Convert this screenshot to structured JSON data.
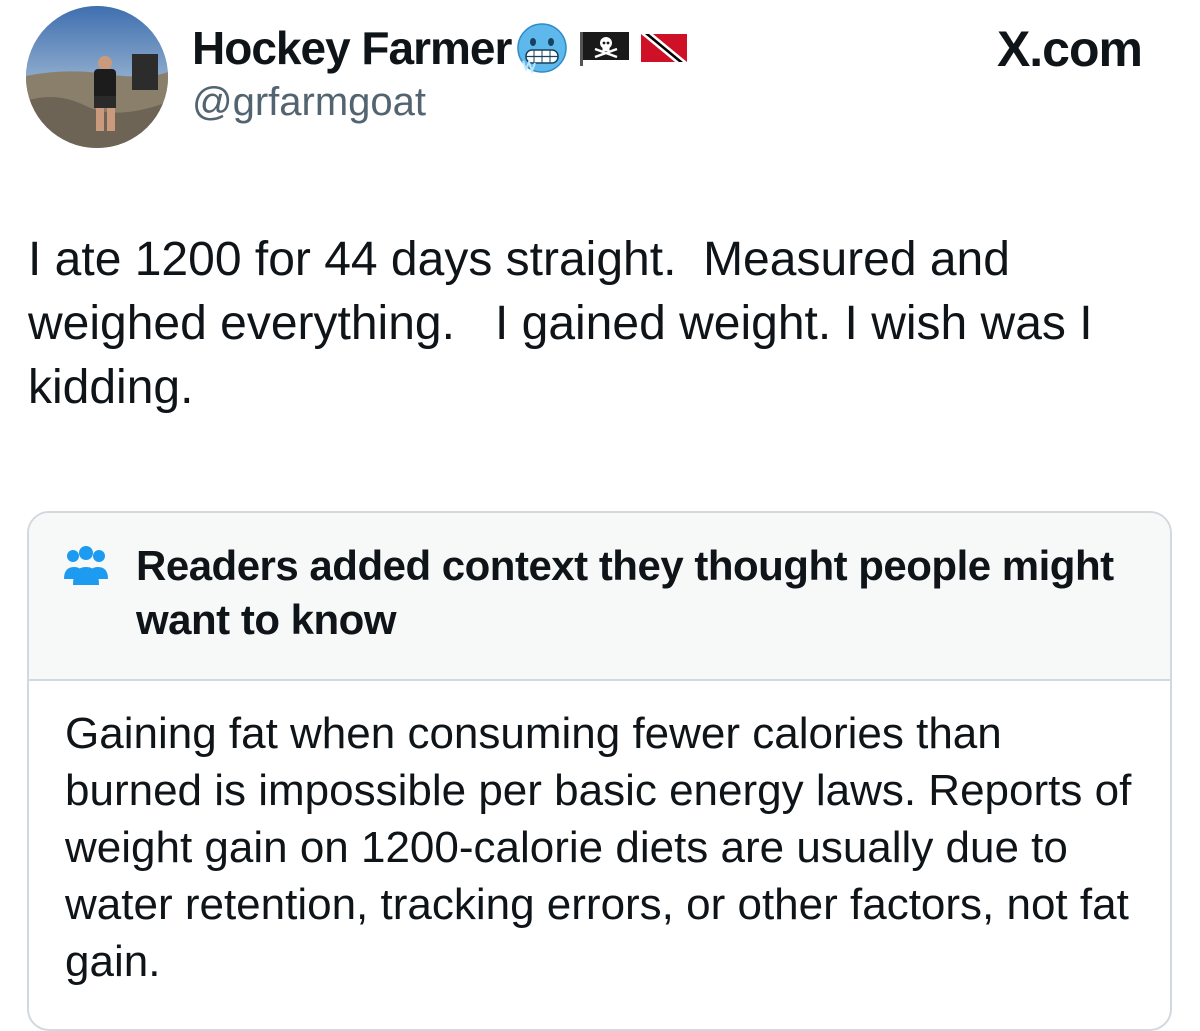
{
  "post": {
    "display_name": "Hockey Farmer",
    "handle": "@grfarmgoat",
    "site_label": "X.com",
    "name_emojis": [
      "cold-face-emoji-icon",
      "pirate-flag-icon",
      "trinidad-and-tobago-flag-icon"
    ],
    "text": "I ate 1200 for 44 days straight.  Measured and weighed everything.   I gained weight. I wish was I kidding."
  },
  "community_note": {
    "icon": "people-group-icon",
    "header": "Readers added context they thought people might want to know",
    "body": "Gaining fat when consuming fewer calories than burned is impossible per basic energy laws. Reports of weight gain on 1200-calorie diets are usually due to water retention, tracking errors, or other factors, not fat gain."
  },
  "colors": {
    "text_primary": "#0f1419",
    "text_secondary": "#536471",
    "note_header_bg": "#f7f9f9",
    "note_border": "#d2d9de",
    "note_icon": "#1d9bf0"
  }
}
